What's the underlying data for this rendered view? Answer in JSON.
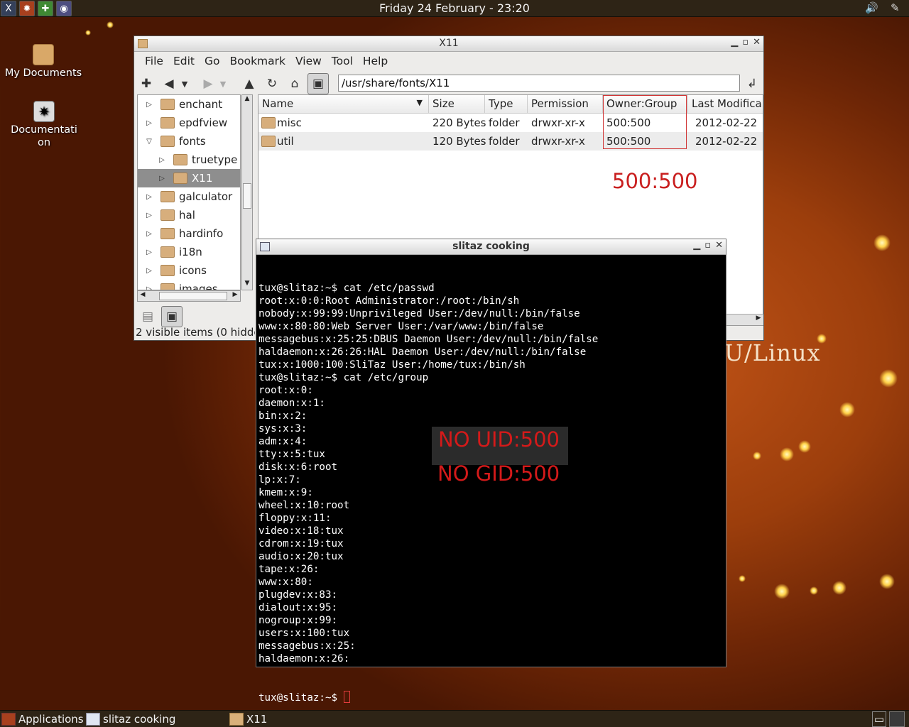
{
  "top_panel": {
    "clock": "Friday 24 February - 23:20",
    "launchers": [
      "xterm-icon",
      "spider-icon",
      "puzzle-icon",
      "disc-icon"
    ]
  },
  "desktop": {
    "icons": [
      {
        "label": "My Documents",
        "icon": "home-folder-icon"
      },
      {
        "label": "Documentation",
        "icon": "spider-doc-icon"
      }
    ],
    "wallpaper_text": "U/Linux"
  },
  "file_manager": {
    "title": "X11",
    "menu": [
      "File",
      "Edit",
      "Go",
      "Bookmark",
      "View",
      "Tool",
      "Help"
    ],
    "path": "/usr/share/fonts/X11",
    "tree": [
      {
        "label": "enchant",
        "expander": "▷",
        "indent": 0
      },
      {
        "label": "epdfview",
        "expander": "▷",
        "indent": 0
      },
      {
        "label": "fonts",
        "expander": "▽",
        "indent": 0
      },
      {
        "label": "truetype",
        "expander": "▷",
        "indent": 1
      },
      {
        "label": "X11",
        "expander": "▷",
        "indent": 1,
        "selected": true
      },
      {
        "label": "galculator",
        "expander": "▷",
        "indent": 0
      },
      {
        "label": "hal",
        "expander": "▷",
        "indent": 0
      },
      {
        "label": "hardinfo",
        "expander": "▷",
        "indent": 0
      },
      {
        "label": "i18n",
        "expander": "▷",
        "indent": 0
      },
      {
        "label": "icons",
        "expander": "▷",
        "indent": 0
      },
      {
        "label": "images",
        "expander": "▷",
        "indent": 0
      }
    ],
    "columns": [
      "Name",
      "Size",
      "Type",
      "Permission",
      "Owner:Group",
      "Last Modifica"
    ],
    "rows": [
      {
        "name": "misc",
        "size": "220 Bytes",
        "type": "folder",
        "permission": "drwxr-xr-x",
        "owner": "500:500",
        "modified": "2012-02-22"
      },
      {
        "name": "util",
        "size": "120 Bytes",
        "type": "folder",
        "permission": "drwxr-xr-x",
        "owner": "500:500",
        "modified": "2012-02-22"
      }
    ],
    "status": "2 visible items (0 hidde",
    "annotation": "500:500"
  },
  "terminal": {
    "title": "slitaz cooking",
    "lines": [
      "tux@slitaz:~$ cat /etc/passwd",
      "root:x:0:0:Root Administrator:/root:/bin/sh",
      "nobody:x:99:99:Unprivileged User:/dev/null:/bin/false",
      "www:x:80:80:Web Server User:/var/www:/bin/false",
      "messagebus:x:25:25:DBUS Daemon User:/dev/null:/bin/false",
      "haldaemon:x:26:26:HAL Daemon User:/dev/null:/bin/false",
      "tux:x:1000:100:SliTaz User:/home/tux:/bin/sh",
      "tux@slitaz:~$ cat /etc/group",
      "root:x:0:",
      "daemon:x:1:",
      "bin:x:2:",
      "sys:x:3:",
      "adm:x:4:",
      "tty:x:5:tux",
      "disk:x:6:root",
      "lp:x:7:",
      "kmem:x:9:",
      "wheel:x:10:root",
      "floppy:x:11:",
      "video:x:18:tux",
      "cdrom:x:19:tux",
      "audio:x:20:tux",
      "tape:x:26:",
      "www:x:80:",
      "plugdev:x:83:",
      "dialout:x:95:",
      "nogroup:x:99:",
      "users:x:100:tux",
      "messagebus:x:25:",
      "haldaemon:x:26:"
    ],
    "prompt": "tux@slitaz:~$ ",
    "annotation_uid": "NO UID:500",
    "annotation_gid": "NO GID:500"
  },
  "bottom_panel": {
    "applications": "Applications",
    "tasks": [
      "slitaz cooking",
      "X11"
    ]
  },
  "colors": {
    "annotation_red": "#c91f1f",
    "panel": "#2e2416",
    "selection": "#8e8e8e"
  }
}
